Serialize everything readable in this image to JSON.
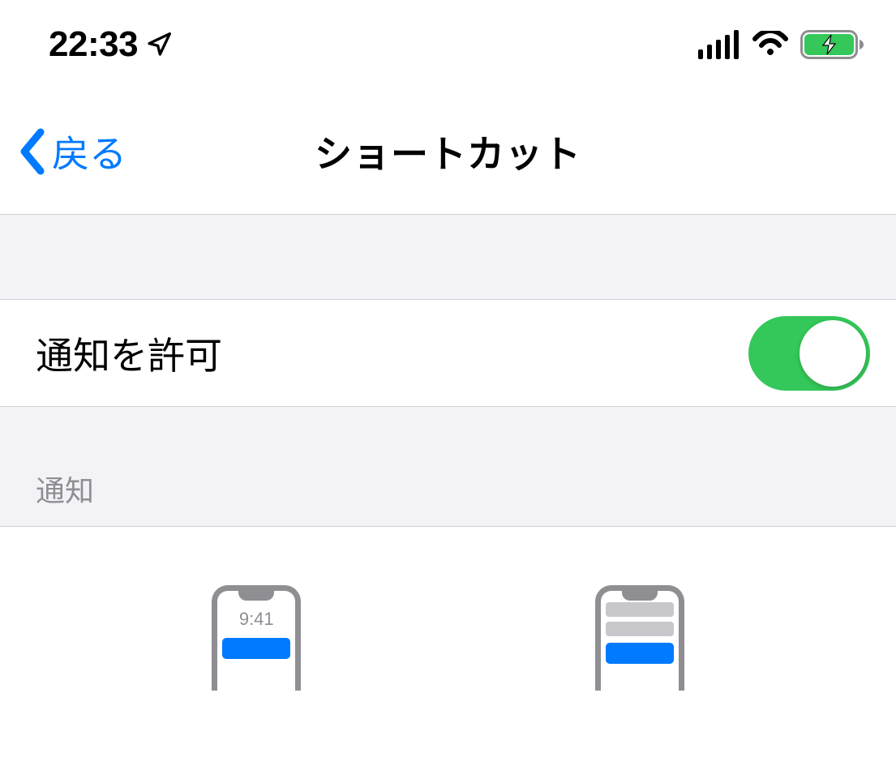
{
  "statusBar": {
    "time": "22:33"
  },
  "nav": {
    "backLabel": "戻る",
    "title": "ショートカット"
  },
  "allowNotifications": {
    "label": "通知を許可",
    "enabled": true
  },
  "section": {
    "header": "通知"
  },
  "preview": {
    "lockScreen": {
      "time": "9:41"
    }
  }
}
